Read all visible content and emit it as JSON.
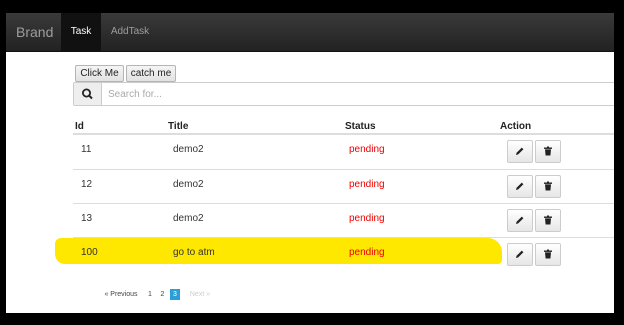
{
  "navbar": {
    "brand": "Brand",
    "tabs": [
      {
        "label": "Task",
        "active": true
      },
      {
        "label": "AddTask",
        "active": false
      }
    ]
  },
  "toolbar": {
    "click_me_label": "Click Me",
    "catch_me_label": "catch me"
  },
  "search": {
    "icon": "search-icon",
    "placeholder": "Search for..."
  },
  "table": {
    "headers": [
      "Id",
      "Title",
      "Status",
      "Action"
    ],
    "rows": [
      {
        "id": "11",
        "title": "demo2",
        "status": "pending",
        "highlighted": false
      },
      {
        "id": "12",
        "title": "demo2",
        "status": "pending",
        "highlighted": false
      },
      {
        "id": "13",
        "title": "demo2",
        "status": "pending",
        "highlighted": false
      },
      {
        "id": "100",
        "title": "go to atm",
        "status": "pending",
        "highlighted": true
      }
    ],
    "action_icons": [
      "pencil-icon",
      "trash-icon"
    ]
  },
  "pagination": {
    "previous": "« Previous",
    "pages": [
      "1",
      "2",
      "3"
    ],
    "current_page": "3",
    "next": "Next »"
  },
  "colors": {
    "navbar": "#222222",
    "status_pending": "#e00000",
    "highlight": "#ffe800",
    "active_page": "#2a9fd6"
  }
}
